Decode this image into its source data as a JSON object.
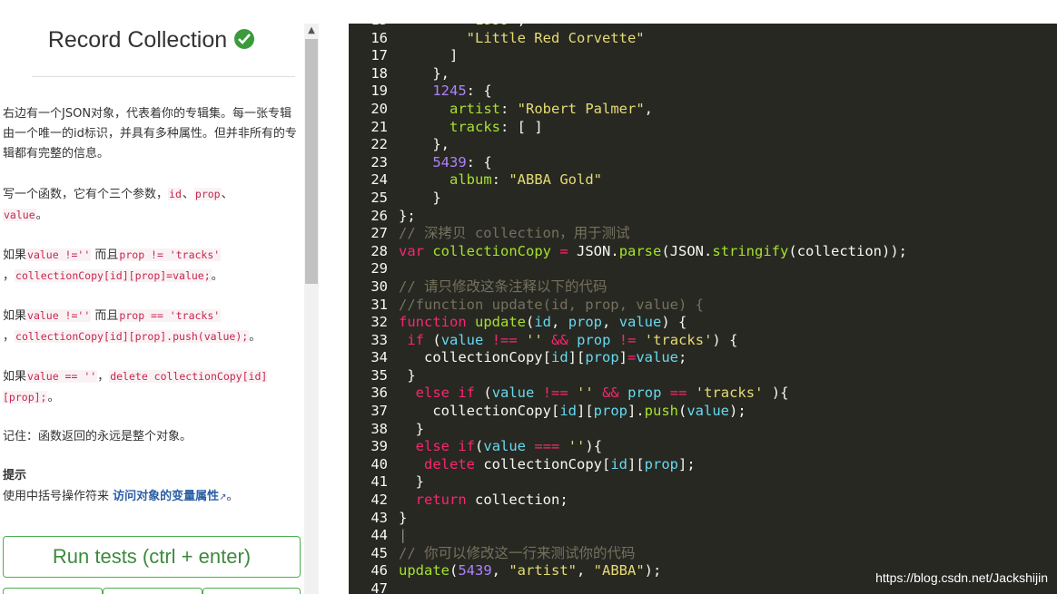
{
  "challenge": {
    "title": "Record Collection",
    "p1": "右边有一个JSON对象，代表着你的专辑集。每一张专辑由一个唯一的id标识，并具有多种属性。但并非所有的专辑都有完整的信息。",
    "p2_pre": "写一个函数，它有个三个参数，",
    "p2_c1": "id",
    "p2_sep1": "、",
    "p2_c2": "prop",
    "p2_sep2": "、",
    "p2_c3": "value",
    "p2_post": "。",
    "p3_pre": "如果",
    "p3_c1": "value !=''",
    "p3_mid": "而且",
    "p3_c2": "prop != 'tracks'",
    "p3_comma": "，",
    "p3_c3": "collectionCopy[id][prop]=value;",
    "p3_post": "。",
    "p4_pre": "如果",
    "p4_c1": "value !=''",
    "p4_mid": "而且",
    "p4_c2": "prop == 'tracks'",
    "p4_comma": "，",
    "p4_c3": "collectionCopy[id][prop].push(value);",
    "p4_post": "。",
    "p5_pre": "如果",
    "p5_c1": "value == ''",
    "p5_comma": "，",
    "p5_c2": "delete collectionCopy[id][prop];",
    "p5_post": "。",
    "p6": "记住：函数返回的永远是整个对象。",
    "hint_title": "提示",
    "hint_pre": "使用中括号操作符来 ",
    "hint_link": "访问对象的变量属性",
    "hint_post": "。",
    "run_label": "Run tests (ctrl + enter)"
  },
  "colors": {
    "editor_bg": "#272822",
    "check": "#3c9a3c",
    "run_border": "#4caf50"
  },
  "watermark": "https://blog.csdn.net/Jackshijin"
}
